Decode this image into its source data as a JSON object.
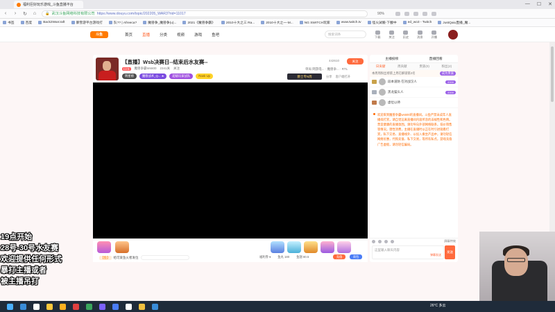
{
  "browser": {
    "tab_title": "福利巨好玩乐游戏_斗鱼直播平台",
    "url_site": "武汉斗鱼网络科技有限公司",
    "url_path": "https://www.douyu.com/topic/202205_WAR3?rid=11017",
    "zoom": "90%",
    "bookmarks": [
      "书签",
      "百度",
      "Back2Warcraft",
      "暴雪游平台游戏打",
      "队?? | Afreeca?",
      "魔兽争_魔兽争(u)...",
      "2021《魔兽争霸》",
      "2010十大之三 Ra...",
      "2010十大之一-M...",
      "NG SWITCH玩家",
      "www.twitch.tv",
      "怪火試驗-下載中",
      "ed_wo3 - Twitch",
      "JustQaiu直播_魔..."
    ]
  },
  "site": {
    "logo": "斗鱼",
    "nav": [
      "首页",
      "直播",
      "分类",
      "视频",
      "游戏",
      "鱼吧"
    ],
    "nav_active": "直播",
    "search_placeholder": "搜索词条",
    "header_icons": [
      "下载",
      "关注",
      "历史",
      "消息",
      "开播"
    ]
  },
  "room": {
    "title": "【直播】Wsb决赛日--结束后水友赛--",
    "category": "单局",
    "tags_line": "网游电... · 魔兽争... · RTL",
    "level": "LV.5",
    "streamer_name": "魔兽争霸Ws600",
    "fans": "2341关",
    "fans_label": "关注",
    "hot": "442610",
    "follow": "关注",
    "tag_list": [
      "明星榜",
      "魔兽战术_Q... ★",
      "超级玩家战队",
      "Rank Up"
    ],
    "nobility": "爵士专N周",
    "links": [
      "分享",
      "客户端打开"
    ],
    "avatar_caption": "鱼塘 | 比赛"
  },
  "gift_bar": {
    "label_tag": "【鱼】",
    "label_text": "给可爱鱼火者发位",
    "stats": [
      "福利券 ▾",
      "鱼丸 180",
      "鱼翅 80.5"
    ],
    "recharge": "充值",
    "backpack": "背包"
  },
  "side": {
    "top_tabs": [
      "主播投榜",
      "直播回看"
    ],
    "rank_tabs": [
      "日贡献",
      "周贡献",
      "贵族(0)",
      "粉丝(2)"
    ],
    "rank_tabs_active": "日贡献",
    "rank_head_text": "本周周粉丝榜第上周已解锁第2名",
    "rank_head_btn": "成为贵族",
    "ranks": [
      {
        "name": "段本道防 在对战汉人",
        "score": "2000"
      },
      {
        "name": "黑龙猫头人",
        "score": "2000"
      },
      {
        "name": "虚位以待",
        "score": ""
      }
    ],
    "notice": "欢迎来到魔兽争霸ws600的直播间。斗鱼严禁未成年人直播或打赏，请自觉远离直播间内容所含的非规性和色情。营造健康的直播氛围。请勿导向外部网络联系，低价销售等情况。理性消费，主播在直播时以正在时引进观看打赏，私下交易、直播线外、以投入乘坐产品中，请勿轻信网络优惠，代购充值、私下交易，等所有私点，游戏充值广告虚假，请勿轻信骗局。",
    "block": "屏蔽特效",
    "input_placeholder": "这里输入聊天内容",
    "barrage": "弹幕发送",
    "send": "发送"
  },
  "overlay_lines": [
    "19点开始",
    "28号-30号水友赛",
    "欢迎提供任何形式",
    "暴打主播或者",
    "被主播吊打"
  ],
  "taskbar": {
    "weather": "26°C 多云",
    "icons": [
      "windows",
      "edge",
      "search",
      "files",
      "explorer",
      "app",
      "app",
      "app",
      "app",
      "app",
      "app",
      "app"
    ]
  }
}
